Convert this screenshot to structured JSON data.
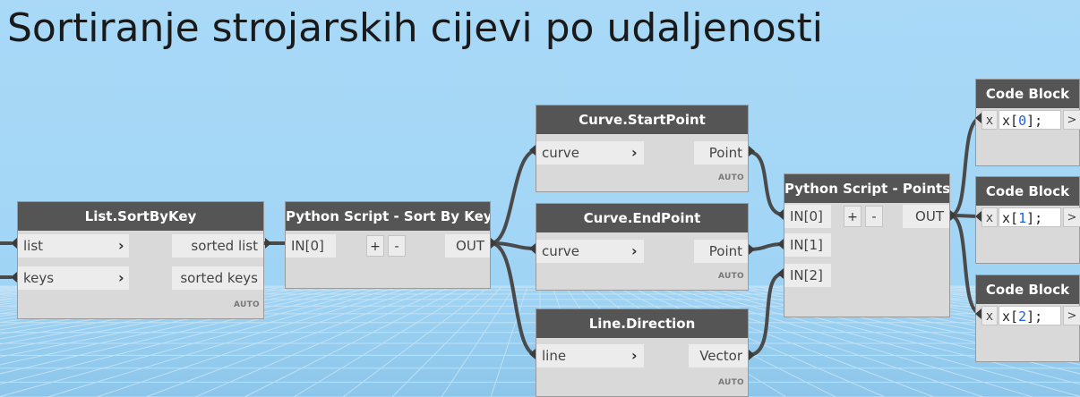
{
  "title": "Sortiranje strojarskih cijevi po udaljenosti",
  "auto_label": "AUTO",
  "chevron": "›",
  "nodes": {
    "sort_by_key": {
      "title": "List.SortByKey",
      "inputs": [
        "list",
        "keys"
      ],
      "outputs": [
        "sorted list",
        "sorted keys"
      ]
    },
    "python_sort": {
      "title": "Python Script - Sort By Key",
      "inputs": [
        "IN[0]"
      ],
      "plus": "+",
      "minus": "-",
      "output": "OUT"
    },
    "start_point": {
      "title": "Curve.StartPoint",
      "input": "curve",
      "output": "Point"
    },
    "end_point": {
      "title": "Curve.EndPoint",
      "input": "curve",
      "output": "Point"
    },
    "line_direction": {
      "title": "Line.Direction",
      "input": "line",
      "output": "Vector"
    },
    "python_points": {
      "title": "Python Script - Points",
      "inputs": [
        "IN[0]",
        "IN[1]",
        "IN[2]"
      ],
      "plus": "+",
      "minus": "-",
      "output": "OUT"
    },
    "code_blocks": [
      {
        "title": "Code Block",
        "var": "x",
        "code_prefix": "x[",
        "index": "0",
        "code_suffix": "];",
        "out": ">"
      },
      {
        "title": "Code Block",
        "var": "x",
        "code_prefix": "x[",
        "index": "1",
        "code_suffix": "];",
        "out": ">"
      },
      {
        "title": "Code Block",
        "var": "x",
        "code_prefix": "x[",
        "index": "2",
        "code_suffix": "];",
        "out": ">"
      }
    ]
  },
  "colors": {
    "background": "#a6d8f6",
    "node_header": "#555555",
    "node_body": "#d9d9d9",
    "wire": "#4a4a4a",
    "code_number": "#1f5fe0"
  }
}
